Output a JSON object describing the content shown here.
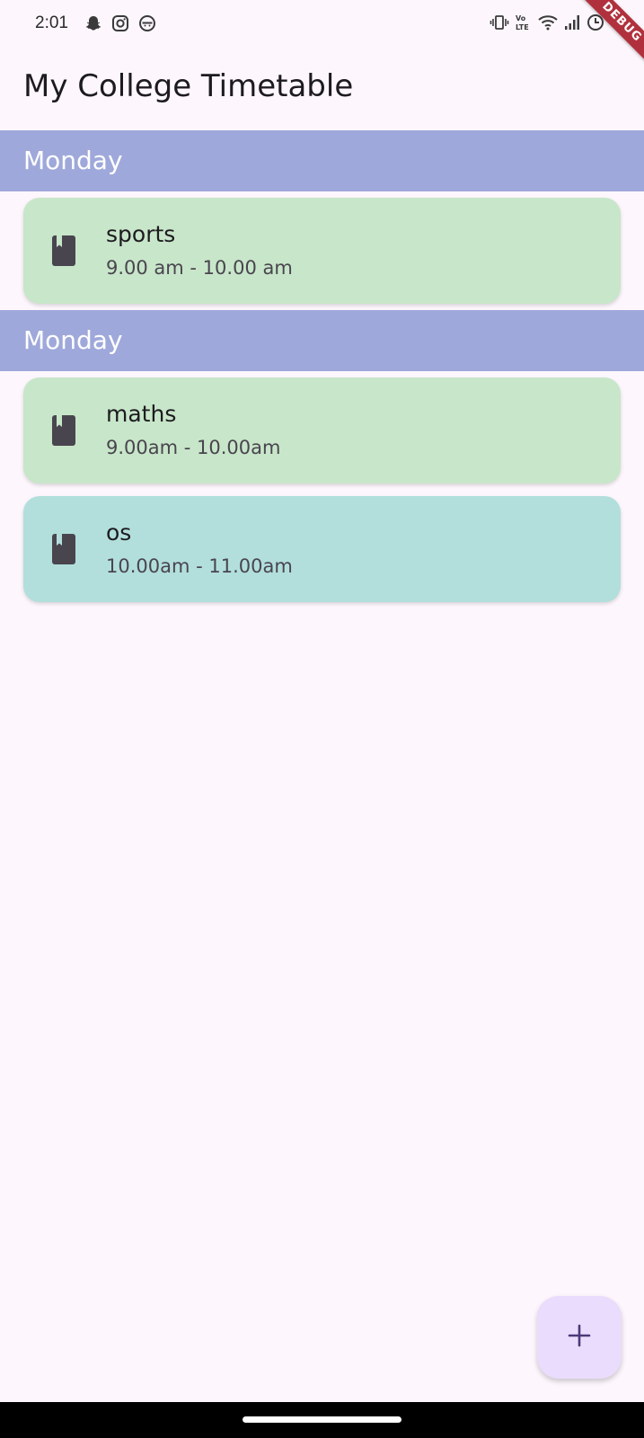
{
  "status_bar": {
    "time": "2:01",
    "left_icons": [
      "snapchat-icon",
      "instagram-icon",
      "app-icon"
    ],
    "right_icons": [
      "vibrate-icon",
      "volte-icon",
      "wifi-icon",
      "signal-icon",
      "battery-icon"
    ]
  },
  "debug_banner": "DEBUG",
  "app": {
    "title": "My College Timetable"
  },
  "groups": [
    {
      "day": "Monday",
      "classes": [
        {
          "subject": "sports",
          "time": "9.00 am - 10.00 am",
          "color": "#c8e6c9",
          "icon": "book-icon"
        }
      ]
    },
    {
      "day": "Monday",
      "classes": [
        {
          "subject": "maths",
          "time": "9.00am - 10.00am",
          "color": "#c8e6c9",
          "icon": "book-icon"
        },
        {
          "subject": "os",
          "time": "10.00am - 11.00am",
          "color": "#b2dfdb",
          "icon": "book-icon"
        }
      ]
    }
  ],
  "fab": {
    "icon": "add-icon"
  },
  "colors": {
    "background": "#fdf7fd",
    "day_header": "#9fa8da",
    "fab": "#eadcfc",
    "debug_banner": "#b0313d"
  }
}
